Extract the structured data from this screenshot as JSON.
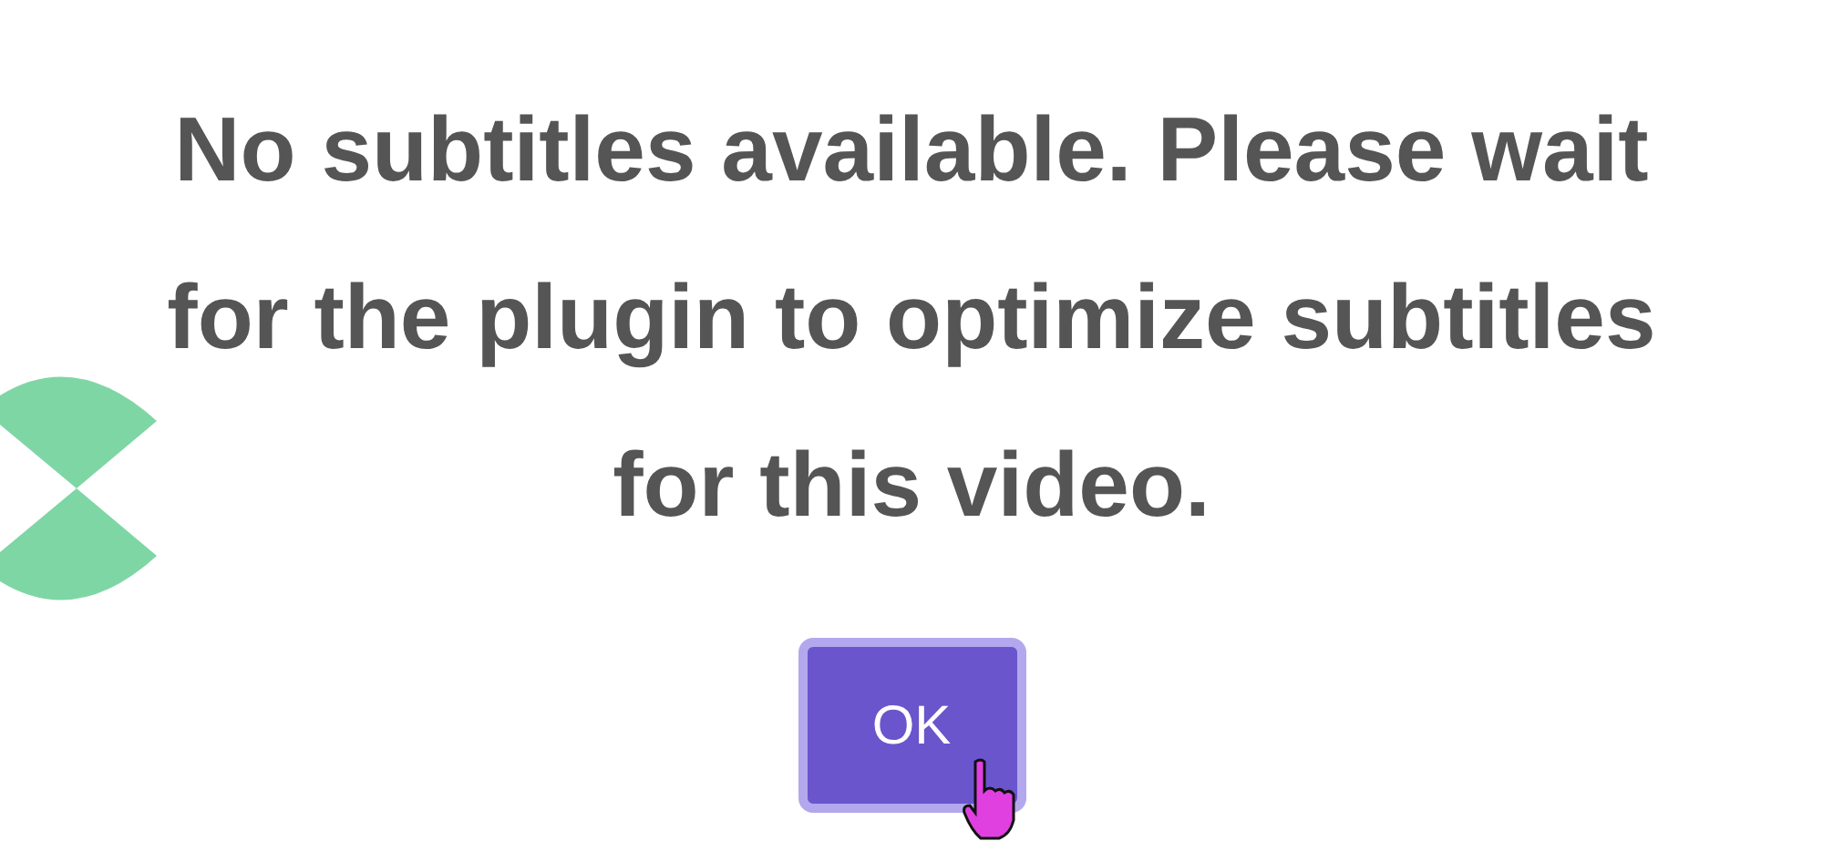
{
  "message": "No subtitles available. Please wait for the plugin to optimize subtitles for this video.",
  "button": {
    "label": "OK"
  }
}
